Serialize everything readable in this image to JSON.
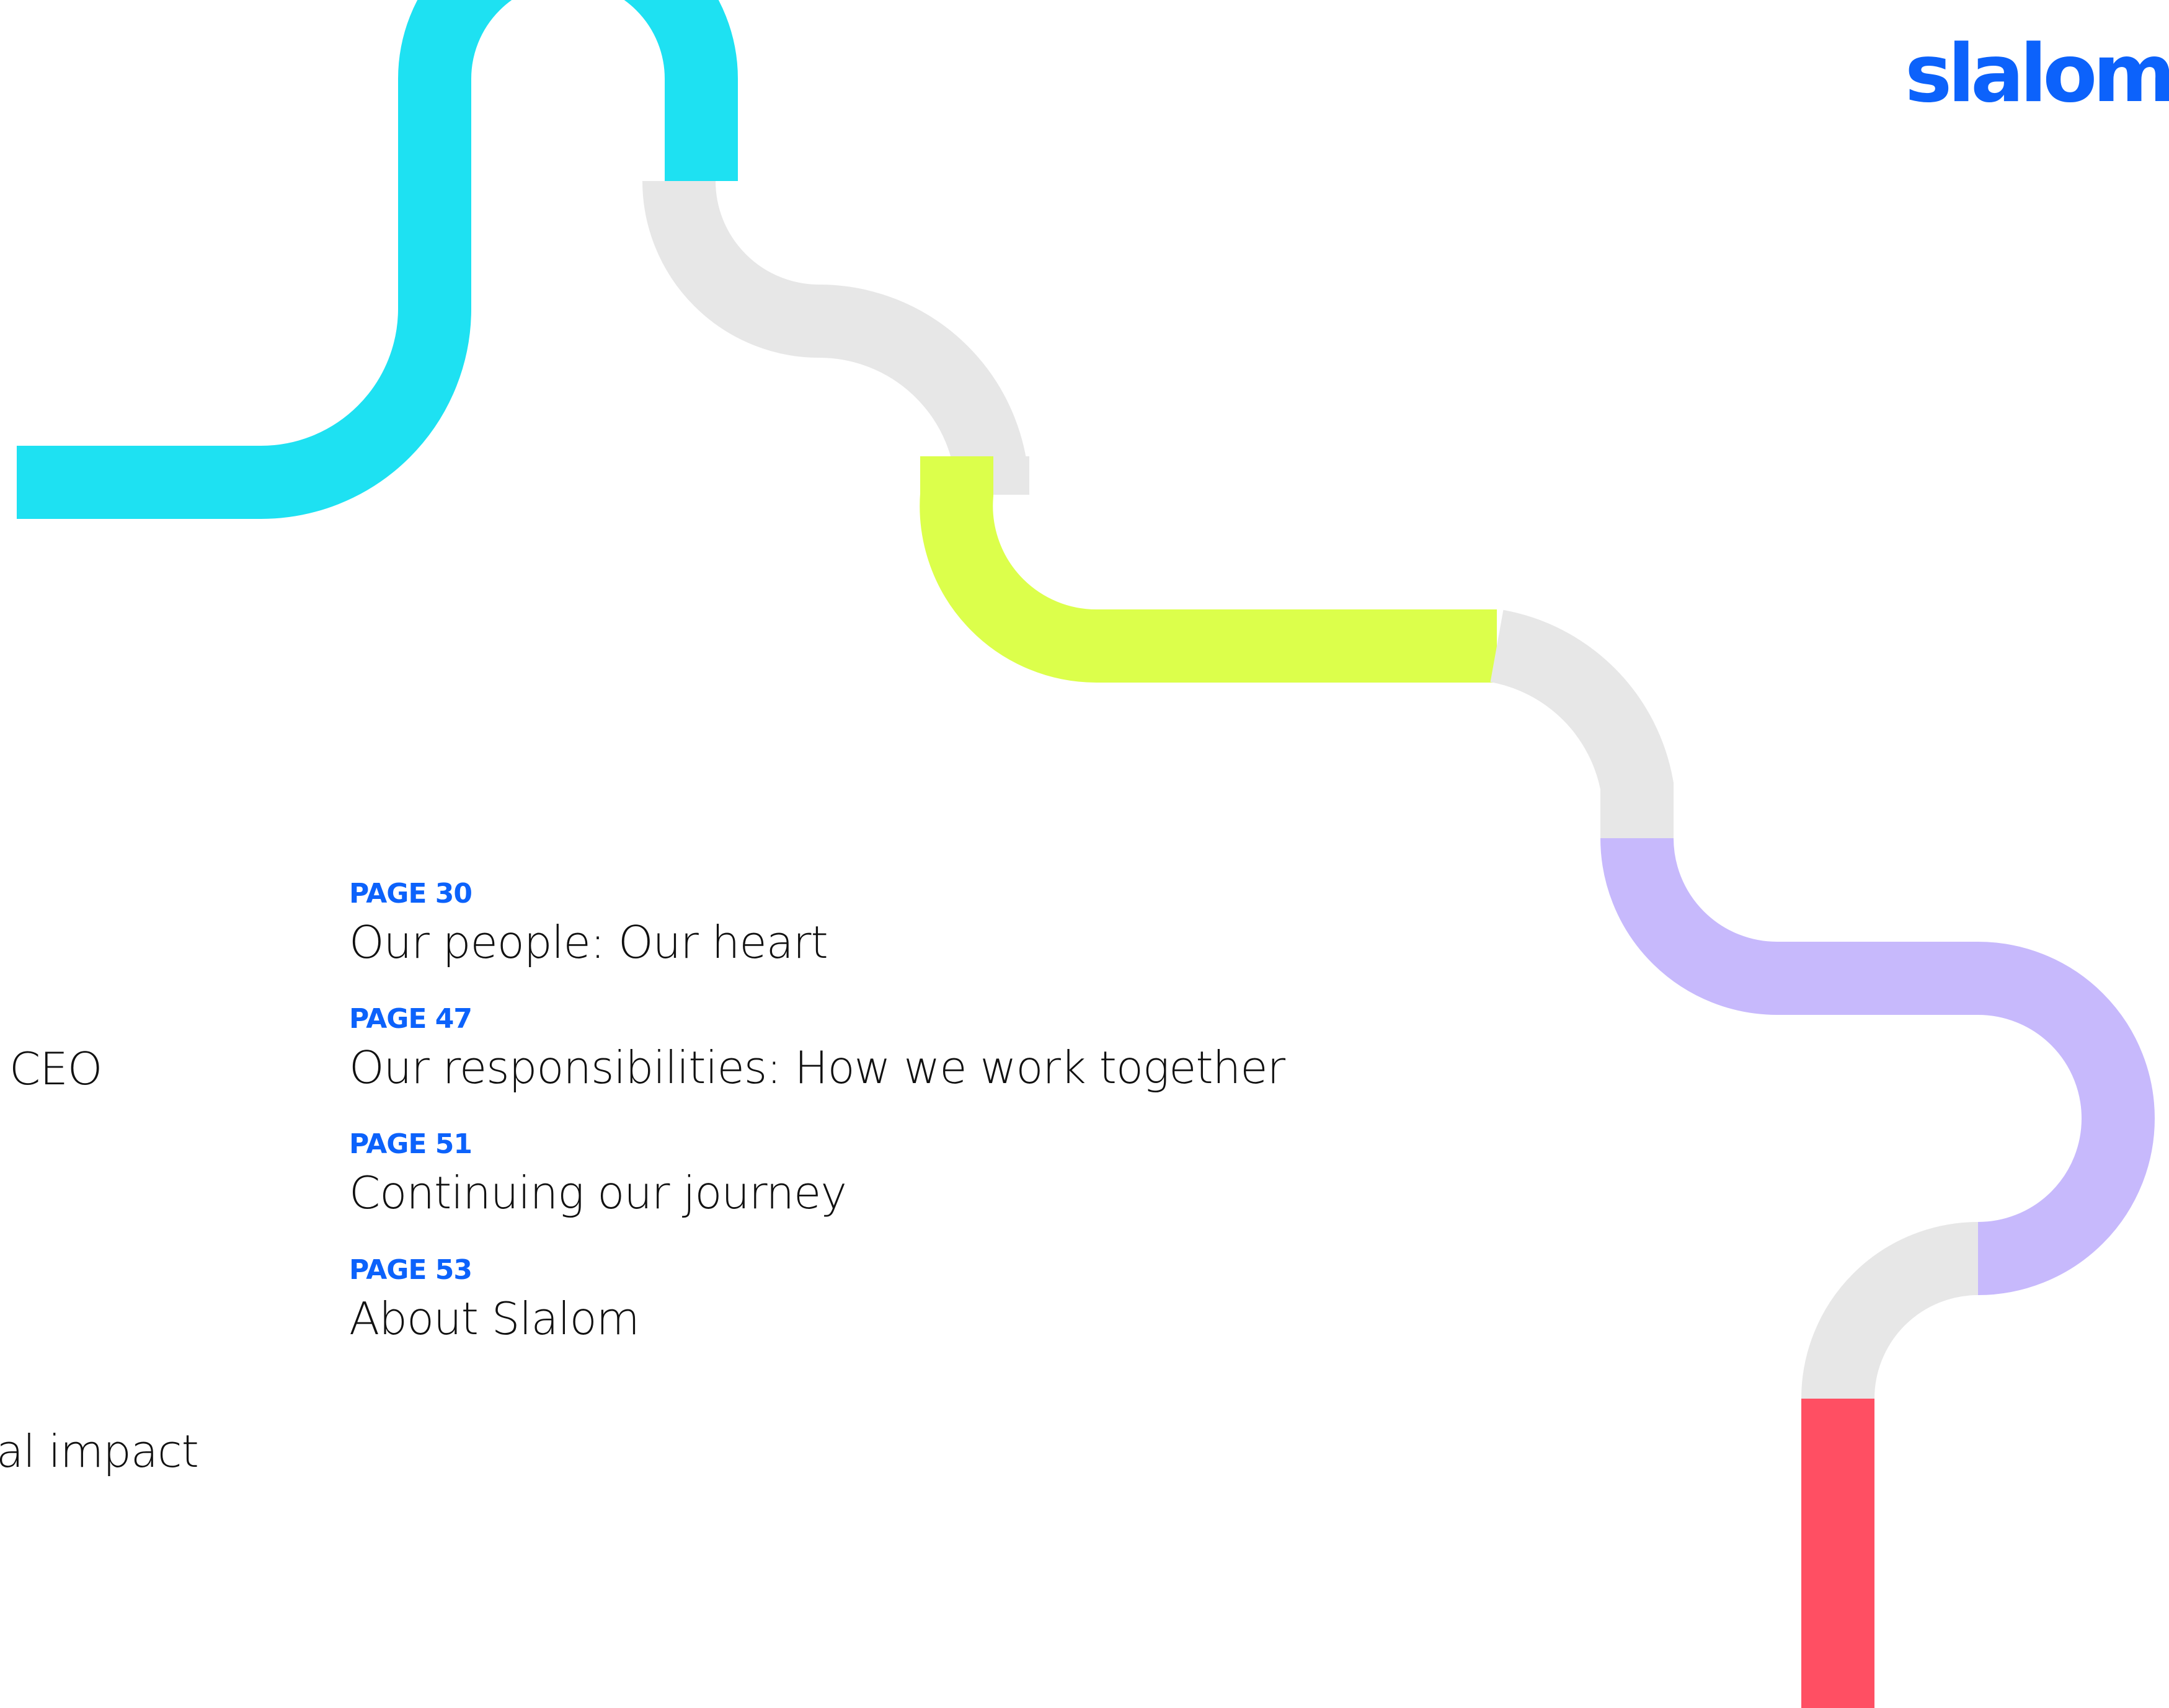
{
  "brand": {
    "logo_text": "slalom",
    "color": "#0c62fb"
  },
  "toc": {
    "entries": [
      {
        "page": "PAGE 30",
        "title": "Our people: Our heart"
      },
      {
        "page": "PAGE 47",
        "title": "Our responsibilities: How we work together"
      },
      {
        "page": "PAGE 51",
        "title": "Continuing our journey"
      },
      {
        "page": "PAGE 53",
        "title": "About Slalom"
      }
    ]
  },
  "clipped_left": {
    "ceo_fragment": "CEO",
    "impact_fragment": "al impact"
  },
  "path_colors": {
    "cyan": "#1ee1f2",
    "gray": "#e7e7e7",
    "lime": "#dcff4b",
    "lavender": "#c7b9fc",
    "red": "#ff4f63"
  }
}
